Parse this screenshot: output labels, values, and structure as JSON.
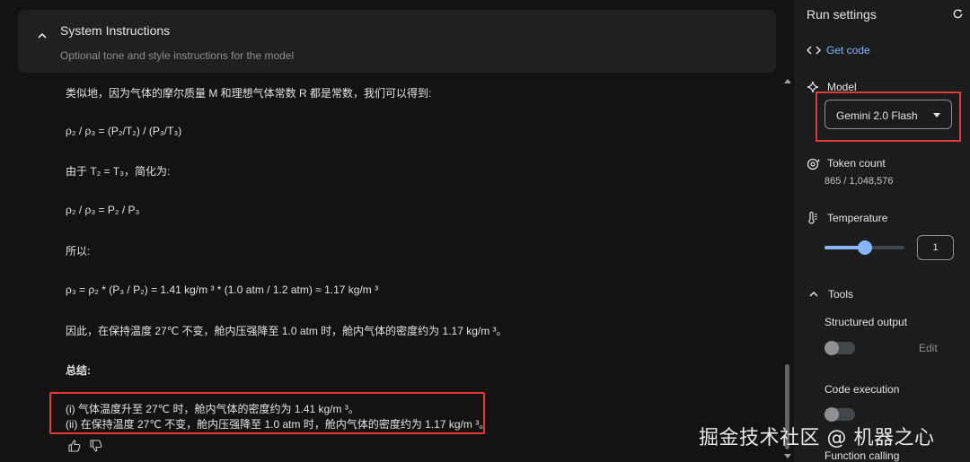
{
  "system_instructions": {
    "title": "System Instructions",
    "placeholder": "Optional tone and style instructions for the model"
  },
  "response": {
    "lines": [
      "类似地，因为气体的摩尔质量 M 和理想气体常数 R 都是常数，我们可以得到:",
      "ρ₂ / ρ₃ = (P₂/T₂) / (P₃/T₃)",
      "由于 T₂ = T₃，简化为:",
      "ρ₂ / ρ₃ = P₂ / P₃",
      "所以:",
      "ρ₃ = ρ₂ * (P₃ / P₂) = 1.41 kg/m ³ * (1.0 atm / 1.2 atm) ≈ 1.17 kg/m ³",
      "因此，在保持温度 27℃ 不变，舱内压强降至 1.0 atm 时，舱内气体的密度约为 1.17 kg/m ³。",
      "总结:"
    ],
    "summary": [
      "(i) 气体温度升至 27℃ 时，舱内气体的密度约为 1.41 kg/m ³。",
      "(ii) 在保持温度 27℃ 不变，舱内压强降至 1.0 atm 时，舱内气体的密度约为 1.17 kg/m ³。"
    ]
  },
  "run_settings": {
    "title": "Run settings",
    "get_code": "Get code",
    "model_label": "Model",
    "model_value": "Gemini 2.0 Flash",
    "token_label": "Token count",
    "token_value": "865 / 1,048,576",
    "temperature_label": "Temperature",
    "temperature_value": "1",
    "temperature_fraction": 0.5,
    "tools_label": "Tools",
    "structured_output_label": "Structured output",
    "edit_label": "Edit",
    "code_execution_label": "Code execution",
    "function_calling_label": "Function calling"
  },
  "watermark": "掘金技术社区 @ 机器之心",
  "colors": {
    "accent": "#8ab4f8",
    "highlight_box": "#e53935",
    "background": "#131314",
    "panel": "#1b1c1d"
  },
  "icons": {
    "chevron_up": "chevron-up-icon",
    "refresh": "refresh-icon",
    "code": "code-icon",
    "model": "model-icon",
    "token": "token-icon",
    "temperature": "thermometer-icon",
    "thumbs_up": "thumbs-up-icon",
    "thumbs_down": "thumbs-down-icon"
  }
}
